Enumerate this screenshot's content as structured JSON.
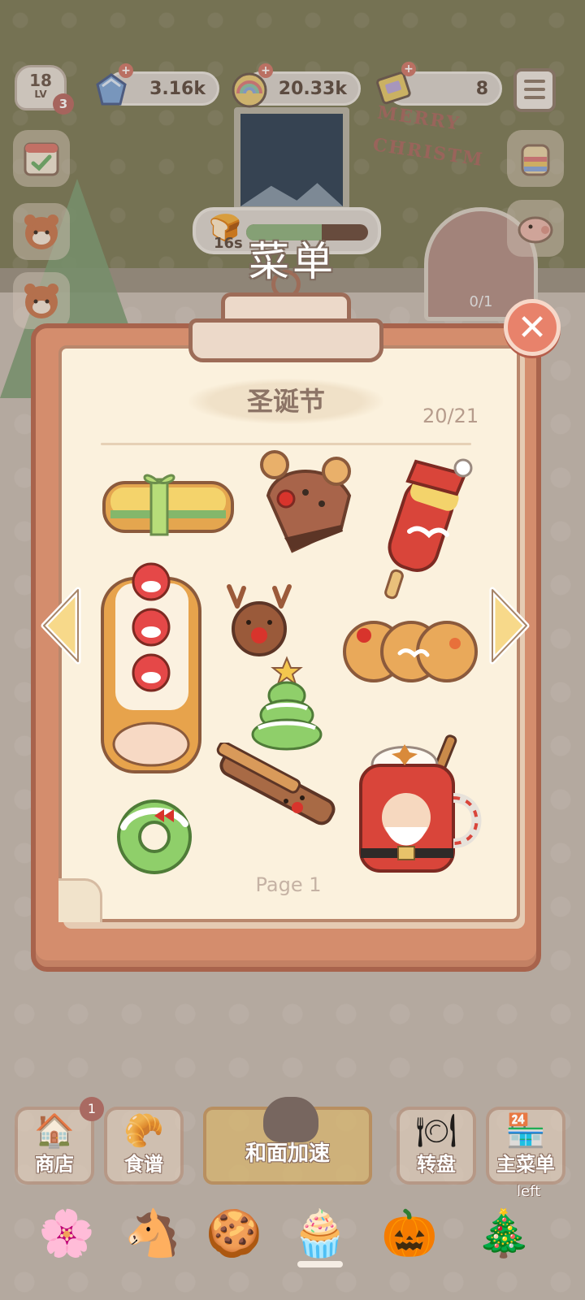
{
  "hud": {
    "level": "18",
    "level_prefix": "LV",
    "level_badge": "3",
    "gems": "3.16k",
    "coins": "20.33k",
    "tickets": "8"
  },
  "timer": {
    "seconds": "16s",
    "progress": 0.62
  },
  "background": {
    "banner_line1": "MERRY",
    "banner_line2": "CHRISTM",
    "house_counter": "0/1"
  },
  "modal": {
    "title": "菜单",
    "section_title": "圣诞节",
    "count": "20/21",
    "page_label": "Page 1",
    "close_symbol": "✕",
    "items": [
      "gift-wrapped-sandwich",
      "reindeer-cake-slice",
      "santa-popsicle",
      "strawberry-santa-roll-cake",
      "reindeer-cookie",
      "reindeer-bread-loaf",
      "matcha-christmas-tree",
      "reindeer-churro",
      "santa-mug-drink",
      "christmas-wreath-donut"
    ]
  },
  "bottom_nav": {
    "shop": "商店",
    "shop_badge": "1",
    "recipes": "食谱",
    "knead_boost": "和面加速",
    "turntable": "转盘",
    "main_menu": "主菜单",
    "left_label": "left"
  },
  "category_tabs": [
    "flower-cookies",
    "carousel-horse",
    "gingerbread",
    "ufo-cupcake",
    "pumpkin",
    "christmas-tree"
  ],
  "colors": {
    "board": "#d48d6d",
    "paper": "#fbf1dd",
    "close": "#e8826b",
    "arrow": "#f7d98a"
  }
}
